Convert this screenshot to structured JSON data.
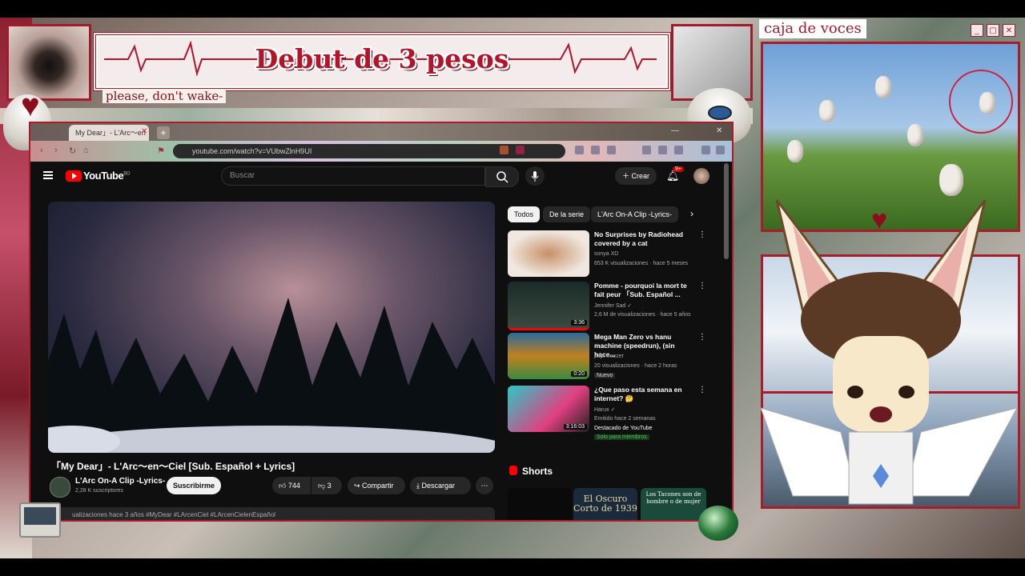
{
  "stream": {
    "banner_title": "Debut de 3 pesos",
    "subtitle": "please, don't wake-",
    "side_window_title": "caja de voces"
  },
  "browser": {
    "tab_label": "My Dear」- L'Arc〜en",
    "url": "youtube.com/watch?v=VUbwZlnH9UI"
  },
  "youtube": {
    "brand": "YouTube",
    "country": "BO",
    "search_placeholder": "Buscar",
    "create_label": "Crear",
    "notif_count": "9+",
    "video_title": "「My Dear」- L'Arc〜en〜Ciel [Sub. Español + Lyrics]",
    "channel_name": "L'Arc On-A Clip -Lyrics-",
    "channel_subs": "2,28 K suscriptores",
    "subscribe_label": "Suscribirme",
    "likes": "744",
    "dislikes": "3",
    "share_label": "Compartir",
    "download_label": "Descargar",
    "description_preview": "ualizaciones hace 3 años #MyDear #LArcenCiel #LArcenCielenEspañol",
    "chips": [
      "Todos",
      "De la serie",
      "L'Arc On-A Clip -Lyrics-"
    ],
    "recommendations": [
      {
        "title": "No Surprises by Radiohead covered by a cat",
        "channel": "sonya XD",
        "meta": "653 K visualizaciones · hace 5 meses",
        "duration": "",
        "extra": "",
        "extra2": ""
      },
      {
        "title": "Pomme - pourquoi la mort te fait peur 「Sub. Español ...",
        "channel": "Jennifer Sad ✓",
        "meta": "2,6 M de visualizaciones · hace 5 años",
        "duration": "3:36",
        "extra": "",
        "extra2": ""
      },
      {
        "title": "Mega Man Zero vs hanu machine (speedrun), (sin hace...",
        "channel": "papi freezer",
        "meta": "20 visualizaciones · hace 2 horas",
        "duration": "0:20",
        "extra": "Nuevo",
        "extra2": ""
      },
      {
        "title": "¿Que paso esta semana en internet? 🤔",
        "channel": "Harux ✓",
        "meta": "Emitido hace 2 semanas",
        "duration": "3:16:03",
        "extra": "Destacado de YouTube",
        "extra2": "Solo para miembros"
      }
    ],
    "shorts_label": "Shorts",
    "shorts": [
      "",
      "El Oscuro Corto de 1939",
      "Los Tacones son de hombre o de mujer"
    ]
  },
  "colors": {
    "accent": "#a81c2c",
    "yt_red": "#ff0000",
    "yt_bg": "#0f0f0f"
  }
}
